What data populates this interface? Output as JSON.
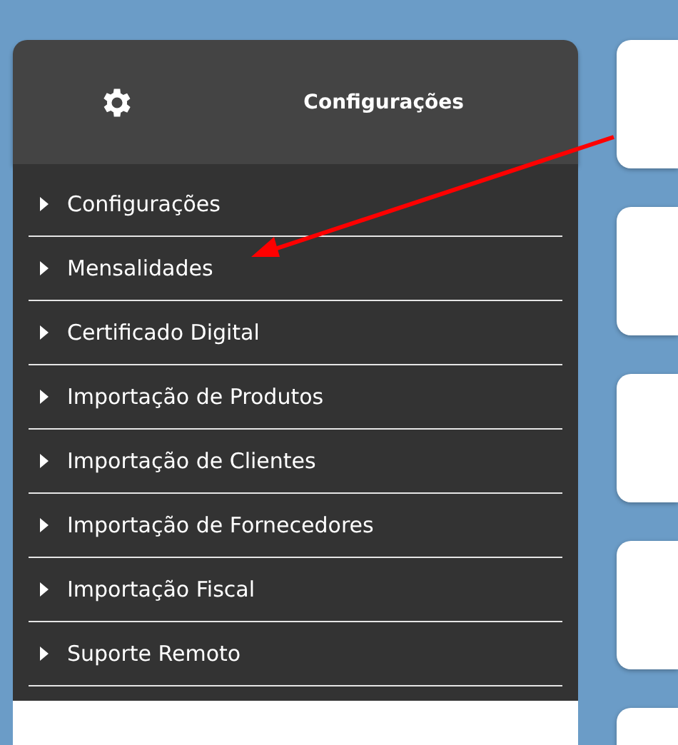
{
  "header": {
    "title": "Configurações"
  },
  "menu": [
    {
      "label": "Configurações"
    },
    {
      "label": "Mensalidades"
    },
    {
      "label": "Certificado Digital"
    },
    {
      "label": "Importação de Produtos"
    },
    {
      "label": "Importação de Clientes"
    },
    {
      "label": "Importação de Fornecedores"
    },
    {
      "label": "Importação Fiscal"
    },
    {
      "label": "Suporte Remoto"
    }
  ]
}
